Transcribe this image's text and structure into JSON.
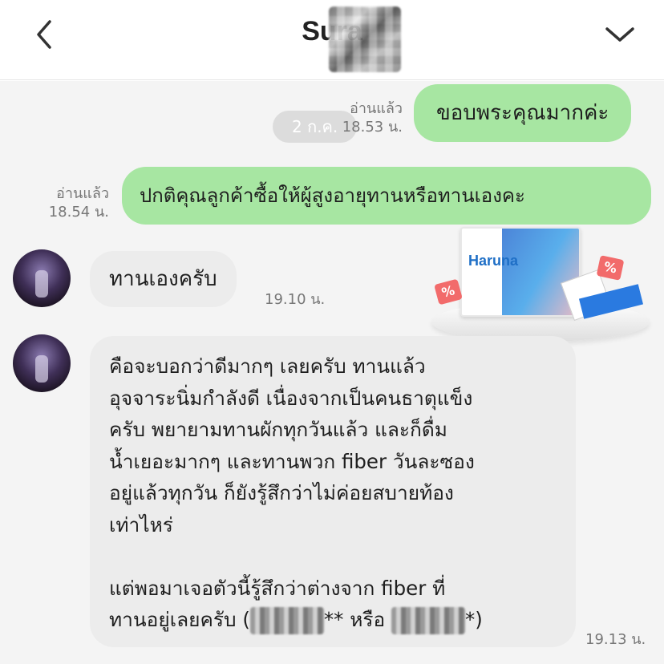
{
  "header": {
    "title": "Sura",
    "back_icon": "chevron-left-icon",
    "menu_icon": "chevron-down-icon"
  },
  "chat": {
    "date_pill": "2 ก.ค.",
    "messages": [
      {
        "side": "out",
        "text": "ขอบพระคุณมากค่ะ",
        "read": "อ่านแล้ว",
        "time": "18.53 น."
      },
      {
        "side": "out",
        "text": "ปกติคุณลูกค้าซื้อให้ผู้สูงอายุทานหรือทานเองคะ",
        "read": "อ่านแล้ว",
        "time": "18.54 น."
      },
      {
        "side": "in",
        "text": "ทานเองครับ",
        "time": "19.10 น."
      },
      {
        "side": "in",
        "lines": [
          "คือจะบอกว่าดีมากๆ เลยครับ ทานแล้ว",
          "อุจจาระนิ่มกำลังดี เนื่องจากเป็นคนธาตุแข็ง",
          "ครับ พยายามทานผักทุกวันแล้ว และก็ดื่ม",
          "น้ำเยอะมากๆ และทานพวก fiber วันละซอง",
          "อยู่แล้วทุกวัน ก็ยังรู้สึกว่าไม่ค่อยสบายท้อง",
          "เท่าไหร่",
          "",
          "แต่พอมาเจอตัวนี้รู้สึกว่าต่างจาก fiber ที่"
        ],
        "last_line_start": "ทานอยู่เลยครับ (",
        "last_line_mid": "** หรือ ",
        "last_line_end": "*)",
        "time": "19.13 น."
      }
    ]
  },
  "product_ad": {
    "brand": "Haruna",
    "tag": "%"
  },
  "colors": {
    "outgoing_bubble": "#a7e6a2",
    "incoming_bubble": "#ececec",
    "chat_background": "#f4f4f4"
  }
}
